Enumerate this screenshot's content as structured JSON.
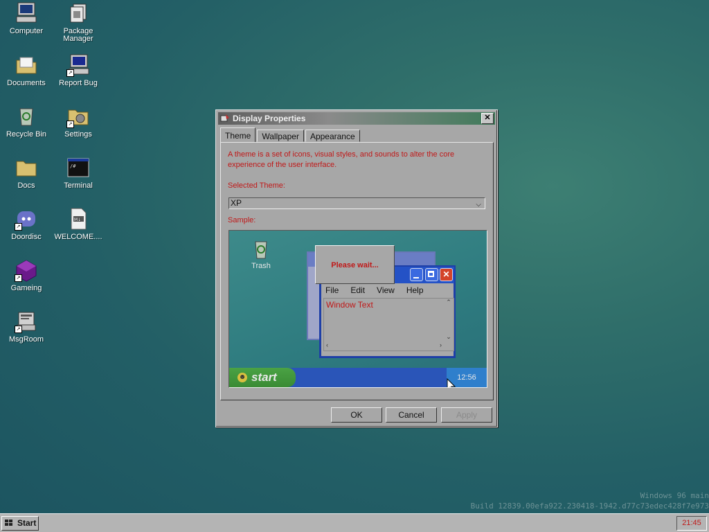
{
  "desktop": {
    "icons": [
      {
        "label": "Computer",
        "icon": "computer-icon"
      },
      {
        "label": "Package Manager",
        "icon": "package-manager-icon"
      },
      {
        "label": "Documents",
        "icon": "documents-folder-icon"
      },
      {
        "label": "Report Bug",
        "icon": "report-bug-icon"
      },
      {
        "label": "Recycle Bin",
        "icon": "recycle-bin-icon"
      },
      {
        "label": "Settings",
        "icon": "settings-icon"
      },
      {
        "label": "Docs",
        "icon": "folder-icon"
      },
      {
        "label": "Terminal",
        "icon": "terminal-icon"
      },
      {
        "label": "Doordisc",
        "icon": "doordisc-icon"
      },
      {
        "label": "WELCOME....",
        "icon": "markdown-file-icon"
      },
      {
        "label": "Gameing",
        "icon": "gameing-icon"
      },
      {
        "label": "MsgRoom",
        "icon": "msgroom-icon"
      }
    ]
  },
  "window": {
    "title": "Display Properties",
    "tabs": [
      {
        "label": "Theme",
        "active": true
      },
      {
        "label": "Wallpaper",
        "active": false
      },
      {
        "label": "Appearance",
        "active": false
      }
    ],
    "description": "A theme is a set of icons, visual styles, and sounds to alter the core experience of the user interface.",
    "selected_theme_label": "Selected Theme:",
    "selected_theme_value": "XP",
    "sample_label": "Sample:",
    "sample": {
      "trash_label": "Trash",
      "please_wait": "Please wait...",
      "menu": [
        "File",
        "Edit",
        "View",
        "Help"
      ],
      "window_text": "Window Text",
      "start_label": "start",
      "clock": "12:56"
    },
    "buttons": {
      "ok": "OK",
      "cancel": "Cancel",
      "apply": "Apply"
    }
  },
  "watermark": {
    "line1": "Windows 96 main",
    "line2": "Build 12839.00efa922.230418-1942.d77c73edec428f7e973"
  },
  "taskbar": {
    "start_label": "Start",
    "clock": "21:45"
  },
  "colors": {
    "accent_text": "#c01818",
    "desktop_bg": "#235f66"
  }
}
